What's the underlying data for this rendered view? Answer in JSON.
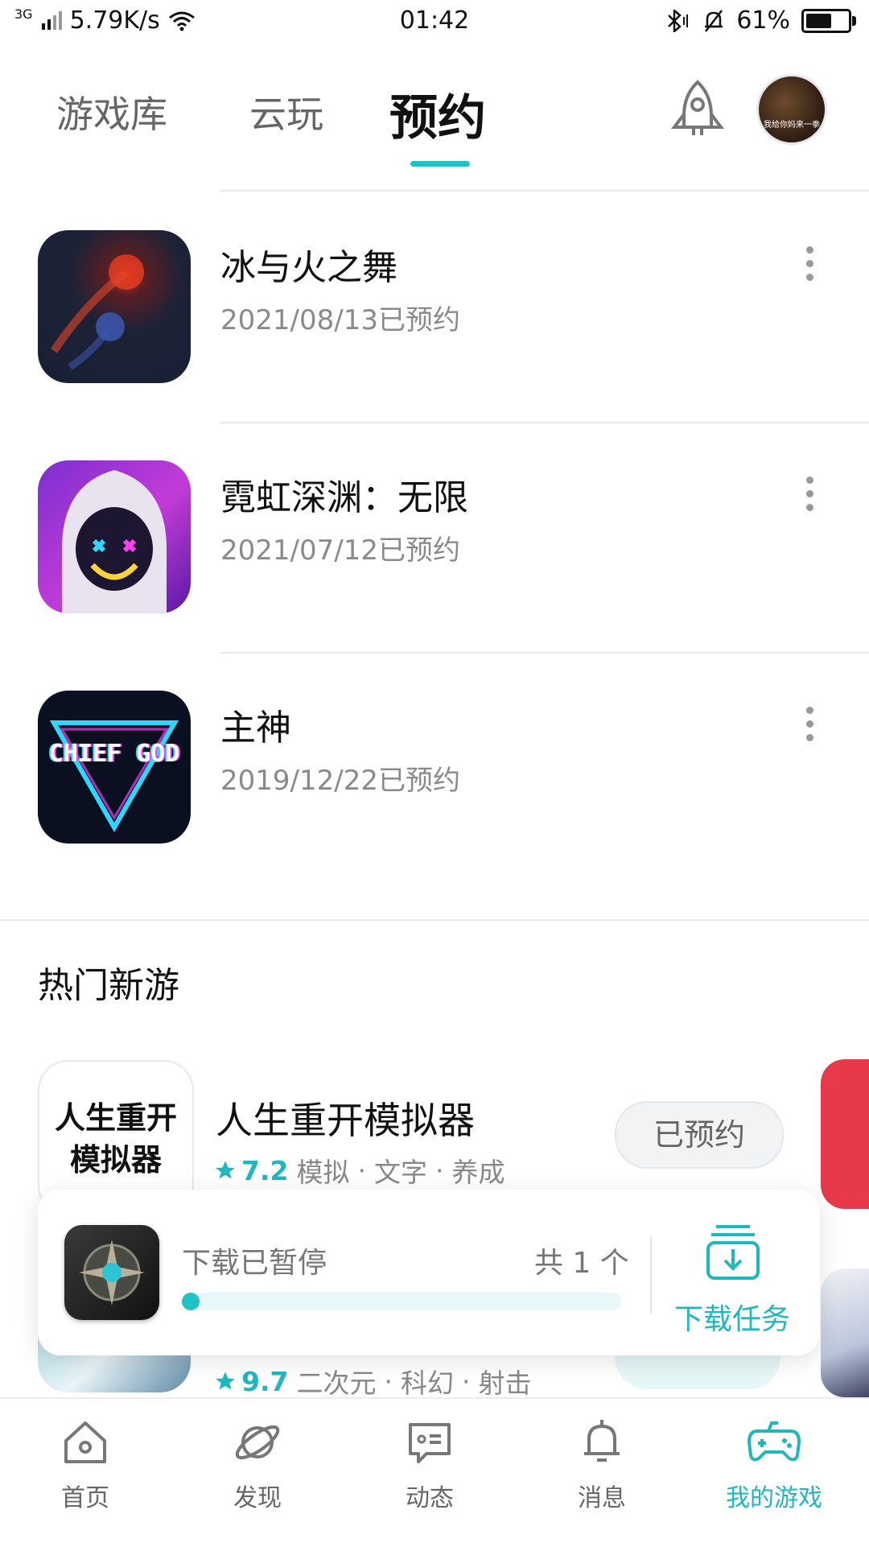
{
  "status_bar": {
    "network": "3G",
    "speed": "5.79K/s",
    "time": "01:42",
    "battery": "61%"
  },
  "top_tabs": [
    {
      "label": "游戏库",
      "active": false
    },
    {
      "label": "云玩",
      "active": false
    },
    {
      "label": "预约",
      "active": true
    }
  ],
  "avatar_text": "我给你妈来一拳",
  "reservations": [
    {
      "title": "冰与火之舞",
      "date": "2021/08/13已预约"
    },
    {
      "title": "霓虹深渊：无限",
      "date": "2021/07/12已预约"
    },
    {
      "title": "主神",
      "date": "2019/12/22已预约",
      "icon_text": "CHIEF GOD"
    }
  ],
  "hot_section": {
    "title": "热门新游",
    "items": [
      {
        "icon_text": "人生重开\n模拟器",
        "title": "人生重开模拟器",
        "rating": "7.2",
        "tags": [
          "模拟",
          "文字",
          "养成"
        ],
        "button": "已预约"
      },
      {
        "rating": "9.7",
        "tags": [
          "二次元",
          "科幻",
          "射击"
        ]
      }
    ]
  },
  "download_card": {
    "status": "下载已暂停",
    "count": "共 1 个",
    "progress": 0.02,
    "task_label": "下载任务"
  },
  "bottom_nav": [
    {
      "label": "首页",
      "icon": "home-icon",
      "active": false
    },
    {
      "label": "发现",
      "icon": "discover-planet-icon",
      "active": false
    },
    {
      "label": "动态",
      "icon": "feed-chat-icon",
      "active": false
    },
    {
      "label": "消息",
      "icon": "bell-icon",
      "active": false
    },
    {
      "label": "我的游戏",
      "icon": "gamepad-icon",
      "active": true
    }
  ],
  "colors": {
    "accent": "#1fc3c6",
    "accent_text": "#1fb8be",
    "text_primary": "#111111",
    "text_secondary": "#8a8a8a"
  }
}
